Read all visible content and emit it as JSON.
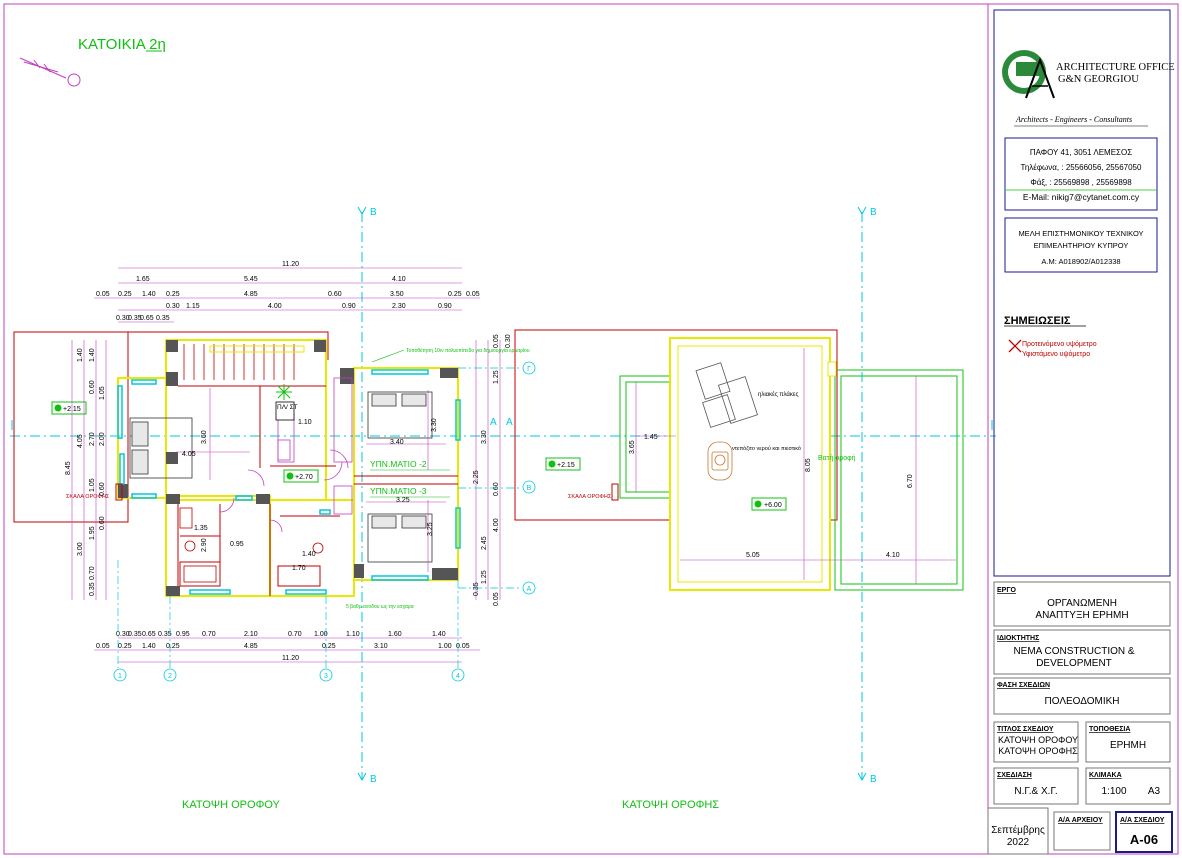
{
  "sheet": {
    "house_title": "ΚΑΤΟΙΚΙΑ 2η",
    "plan_first_floor": "ΚΑΤΟΨΗ ΟΡΟΦΟΥ",
    "plan_roof": "ΚΑΤΟΨΗ ΟΡΟΦΗΣ",
    "colors": {
      "green": "#10c010",
      "magenta": "#c040c0",
      "cyan": "#00c8e0",
      "red": "#c00000",
      "yellow": "#e8e800",
      "blue": "#1a1a8c",
      "grey": "#777777"
    }
  },
  "office": {
    "name_line1": "ARCHITECTURE OFFICE",
    "name_line2": "G&N GEORGIOU",
    "tagline": "Architects - Engineers - Consultants",
    "address": "ΠΑΦΟΥ 41, 3051 ΛΕΜΕΣΟΣ",
    "phones": "Τηλέφωνα, : 25566056, 25567050",
    "fax": "Φάξ, : 25569898 , 25569898",
    "email": "E-Mail: nikig7@cytanet.com.cy",
    "member_line1": "ΜΕΛΗ ΕΠΙΣΤΗΜΟΝΙΚΟΥ ΤΕΧΝΙΚΟΥ",
    "member_line2": "ΕΠΙΜΕΛΗΤΗΡΙΟΥ ΚΥΠΡΟΥ",
    "member_line3": "Α.Μ: Α018902/Α012338",
    "logo_icon": "gn-logo"
  },
  "notes": {
    "heading": "ΣΗΜΕΙΩΣΕΙΣ",
    "legend_proposed": "Προτεινόμενο υψόμετρο",
    "legend_existing": "Υφιστάμενο υψόμετρο"
  },
  "titleblock": {
    "project_label": "ΕΡΓΟ",
    "project_line1": "ΟΡΓΑΝΩΜΕΝΗ",
    "project_line2": "ΑΝΑΠΤΥΞΗ ΕΡΗΜΗ",
    "owner_label": "ΙΔΙΟΚΤΗΤΗΣ",
    "owner_line1": "NEMA CONSTRUCTION &",
    "owner_line2": "DEVELOPMENT",
    "phase_label": "ΦΑΣΗ ΣΧΕΔΙΩΝ",
    "phase": "ΠΟΛΕΟΔΟΜΙΚΗ",
    "drawing_title_label": "ΤΙΤΛΟΣ ΣΧΕΔΙΟΥ",
    "drawing_title_line1": "ΚΑΤΟΨΗ ΟΡΟΦΟΥ",
    "drawing_title_line2": "ΚΑΤΟΨΗ ΟΡΟΦΗΣ",
    "location_label": "ΤΟΠΟΘΕΣΙΑ",
    "location": "ΕΡΗΜΗ",
    "design_label": "ΣΧΕΔΙΑΣΗ",
    "design": "Ν.Γ.& Χ.Γ.",
    "scale_label": "ΚΛΙΜΑΚΑ",
    "scale": "1:100",
    "paper": "A3",
    "date_line1": "Σεπτέμβρης",
    "date_line2": "2022",
    "file_no_label": "Α/Α ΑΡΧΕΙΟΥ",
    "drawing_no_label": "Α/Α ΣΧΕΔΙΟΥ",
    "drawing_no": "A-06"
  },
  "plan": {
    "dims_top_overall": "11.20",
    "dims_top_row2": [
      "1.65",
      "5.45",
      "4.10"
    ],
    "dims_top_row3": [
      "0.05",
      "0.25",
      "1.40",
      "0.25",
      "4.85",
      "0.60",
      "3.50",
      "0.25",
      "0.05"
    ],
    "dims_top_row4": [
      "0.30",
      "1.15",
      "4.00",
      "0.90",
      "2.30",
      "0.90"
    ],
    "dims_top_row5": [
      "0.30",
      "0.35",
      "0.65",
      "0.35"
    ],
    "dims_bot_row1": [
      "0.30",
      "0.35",
      "0.65",
      "0.35",
      "0.95",
      "0.70",
      "2.10",
      "0.70",
      "1.00",
      "1.10",
      "1.60",
      "1.40"
    ],
    "dims_bot_row2": [
      "0.05",
      "0.25",
      "1.40",
      "0.25",
      "4.85",
      "0.25",
      "3.10",
      "1.00",
      "0.05"
    ],
    "dims_bot_overall": "11.20",
    "dims_left": [
      "8.45",
      "4.05",
      "3.00",
      "1.40",
      "1.40",
      "0.60",
      "1.05",
      "2.70",
      "2.00",
      "1.05",
      "0.60",
      "1.95",
      "0.70",
      "0.35",
      "0.60"
    ],
    "dims_right": [
      "0.05",
      "0.30",
      "1.25",
      "3.30",
      "2.25",
      "0.60",
      "4.00",
      "2.45",
      "1.25",
      "0.35",
      "0.05"
    ],
    "inner_dims": [
      "3.60",
      "4.05",
      "1.10",
      "3.40",
      "1.35",
      "2.90",
      "0.95",
      "1.40",
      "1.70",
      "3.25",
      "3.30",
      "3.25",
      "3.30"
    ],
    "room_labels": [
      "ΥΠΝ.ΜΑΤΙΟ -2",
      "ΥΠΝ.ΜΑΤΙΟ -3"
    ],
    "plst_label": "ΠΛ/ ΣΤ",
    "elevations": [
      "+2.15",
      "+2.70"
    ],
    "stair_label": "ΣΚΑΛΑ ΟΡΟΦΗΣ",
    "note_top": "Τοποθέτηση 10ιν πολυεπίπεδο για δημιουργία ερμαρίου",
    "note_bottom": "5 βαθμ ανοδου ως την εσχαρα",
    "grid_letters": [
      "Γ",
      "Β",
      "Α"
    ],
    "grid_numbers": [
      "1",
      "2",
      "3",
      "4"
    ],
    "section_marker": "B",
    "section_marker_a": "A"
  },
  "roof": {
    "dims_bottom": [
      "5.05",
      "4.10"
    ],
    "dims_left": [
      "1.45",
      "3.65"
    ],
    "dims_right": [
      "8.05",
      "6.70"
    ],
    "label_panels": "ηλιακές πλάκες",
    "label_tank": "ντεπόζιτο νερού και πιεστικό",
    "label_flat_roof": "Βατή οροφή",
    "elevations": [
      "+2.15",
      "+6.00"
    ],
    "stair_label": "ΣΚΑΛΑ ΟΡΟΦΗΣ"
  }
}
